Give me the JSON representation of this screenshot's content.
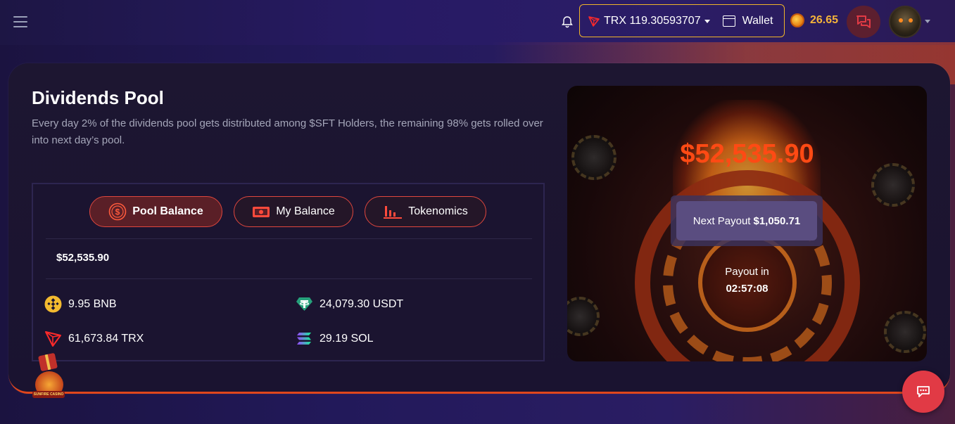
{
  "header": {
    "currency_code": "TRX",
    "currency_balance": "119.30593707",
    "wallet_label": "Wallet",
    "points_balance": "26.65"
  },
  "pool": {
    "title": "Dividends Pool",
    "description": "Every day 2% of the dividends pool gets distributed among $SFT Holders, the remaining 98% gets rolled over into next day’s pool.",
    "tabs": [
      {
        "label": "Pool Balance",
        "icon": "dollar-coin-icon",
        "active": true
      },
      {
        "label": "My Balance",
        "icon": "cash-icon",
        "active": false
      },
      {
        "label": "Tokenomics",
        "icon": "bar-chart-icon",
        "active": false
      }
    ],
    "total": "$52,535.90",
    "assets": [
      {
        "amount": "9.95 BNB",
        "icon": "bnb-icon"
      },
      {
        "amount": "24,079.30 USDT",
        "icon": "tether-icon"
      },
      {
        "amount": "61,673.84 TRX",
        "icon": "tron-icon"
      },
      {
        "amount": "29.19 SOL",
        "icon": "solana-icon"
      }
    ]
  },
  "promo": {
    "amount": "$52,535.90",
    "next_payout_label": "Next Payout",
    "next_payout_value": "$1,050.71",
    "payout_in_label": "Payout in",
    "payout_countdown": "02:57:08"
  },
  "gift": {
    "label": "SUNFIRE CASINO"
  },
  "colors": {
    "accent": "#f0b429",
    "danger": "#e0473e",
    "amount": "#ff4a14",
    "fab": "#e13a45"
  }
}
